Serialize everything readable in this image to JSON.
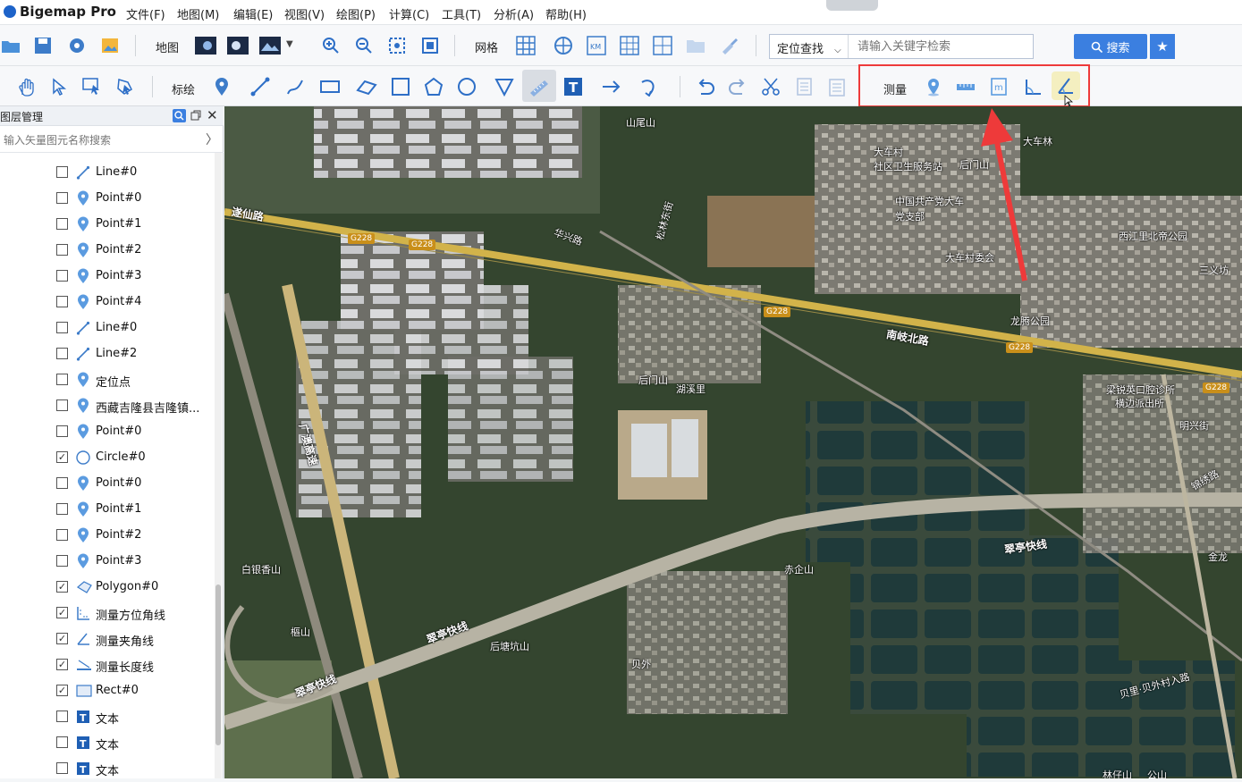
{
  "app": {
    "title": "Bigemap Pro"
  },
  "menu": [
    "文件(F)",
    "地图(M)",
    "编辑(E)",
    "视图(V)",
    "绘图(P)",
    "计算(C)",
    "工具(T)",
    "分析(A)",
    "帮助(H)"
  ],
  "toolbar1": {
    "map_label": "地图",
    "grid_label": "网格",
    "location_mode": "定位查找",
    "search_placeholder": "请输入关键字检索",
    "search_button": "搜索"
  },
  "toolbar2": {
    "draw_label": "标绘",
    "measure_label": "测量"
  },
  "panel": {
    "title": "图层管理",
    "search_placeholder": "输入矢量图元名称搜索",
    "layers": [
      {
        "icon": "line",
        "label": "Line#0",
        "checked": false
      },
      {
        "icon": "point",
        "label": "Point#0",
        "checked": false
      },
      {
        "icon": "point",
        "label": "Point#1",
        "checked": false
      },
      {
        "icon": "point",
        "label": "Point#2",
        "checked": false
      },
      {
        "icon": "point",
        "label": "Point#3",
        "checked": false
      },
      {
        "icon": "point",
        "label": "Point#4",
        "checked": false
      },
      {
        "icon": "line",
        "label": "Line#0",
        "checked": false
      },
      {
        "icon": "line",
        "label": "Line#2",
        "checked": false
      },
      {
        "icon": "point",
        "label": "定位点",
        "checked": false
      },
      {
        "icon": "point",
        "label": "西藏吉隆县吉隆镇...",
        "checked": false
      },
      {
        "icon": "point",
        "label": "Point#0",
        "checked": false
      },
      {
        "icon": "circle",
        "label": "Circle#0",
        "checked": true
      },
      {
        "icon": "point",
        "label": "Point#0",
        "checked": false
      },
      {
        "icon": "point",
        "label": "Point#1",
        "checked": false
      },
      {
        "icon": "point",
        "label": "Point#2",
        "checked": false
      },
      {
        "icon": "point",
        "label": "Point#3",
        "checked": false
      },
      {
        "icon": "polygon",
        "label": "Polygon#0",
        "checked": true
      },
      {
        "icon": "azimuth",
        "label": "测量方位角线",
        "checked": true
      },
      {
        "icon": "angle",
        "label": "测量夹角线",
        "checked": true
      },
      {
        "icon": "length",
        "label": "测量长度线",
        "checked": true
      },
      {
        "icon": "rect",
        "label": "Rect#0",
        "checked": true
      },
      {
        "icon": "text",
        "label": "文本",
        "checked": false
      },
      {
        "icon": "text",
        "label": "文本",
        "checked": false
      },
      {
        "icon": "text",
        "label": "文本",
        "checked": false
      }
    ]
  },
  "map": {
    "labels": {
      "shanweishan": "山尾山",
      "dachecun": "大车村",
      "sqwsfwz": "社区卫生服务站",
      "houmenshan1": "后门山",
      "dachelin": "大车林",
      "zggcd": "中国共产党大车",
      "dangzhibu": "党支部",
      "dacwh": "大车村委会",
      "xijiangli": "西江里北帝公园",
      "longteng": "龙腾公园",
      "houmenshan2": "后门山",
      "hushanli": "湖溪里",
      "liangrui": "梁锐英口腔诊所",
      "hengbian": "横边派出所",
      "mingxing": "明兴街",
      "baiyin": "白银香山",
      "chiqi": "赤企山",
      "zhishan": "樞山",
      "houtang": "后塘坑山",
      "beiwai": "贝外",
      "beili": "贝里·贝外村入路",
      "linzai": "林仔山",
      "gongshan": "公山",
      "jinlong": "金龙",
      "suixian": "遂仙路",
      "nanqi": "南岐北路",
      "cuiting1": "翠亭快线",
      "cuiting2": "翠亭快线",
      "cuiting3": "翠亭快线",
      "guangao": "广澳高速",
      "huaxing": "华兴路",
      "songlin": "松林东街",
      "jinxiu": "锦绣路",
      "sanyi": "三义坊"
    },
    "road_shields": [
      "G228",
      "G228",
      "G228",
      "G228",
      "G228"
    ]
  }
}
